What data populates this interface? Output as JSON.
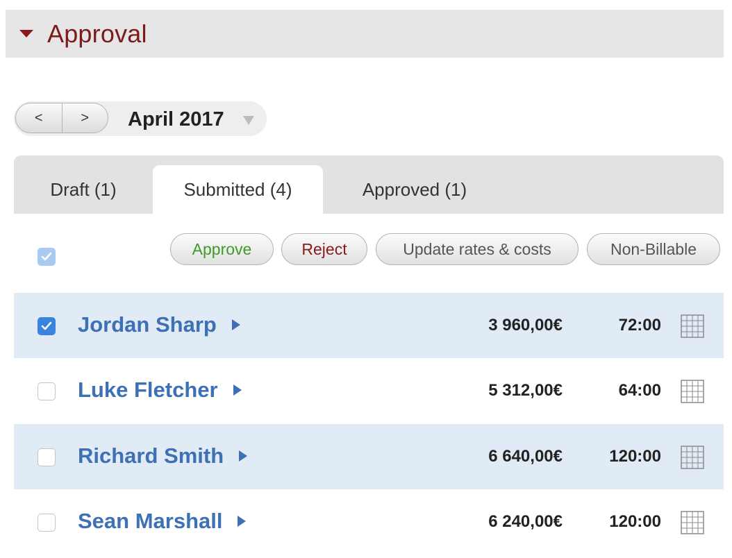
{
  "section": {
    "title": "Approval"
  },
  "month_nav": {
    "prev_label": "<",
    "next_label": ">",
    "month": "April 2017"
  },
  "tabs": [
    {
      "label": "Draft (1)",
      "active": false
    },
    {
      "label": "Submitted (4)",
      "active": true
    },
    {
      "label": "Approved (1)",
      "active": false
    }
  ],
  "toolbar": {
    "approve_label": "Approve",
    "reject_label": "Reject",
    "update_label": "Update rates & costs",
    "nonbillable_label": "Non-Billable"
  },
  "colors": {
    "approve": "#3f9a2a",
    "reject": "#8b1a1a",
    "name": "#3d70b5",
    "accent_check": "#3a84e0"
  },
  "rows": [
    {
      "name": "Jordan Sharp",
      "amount": "3 960,00€",
      "hours": "72:00",
      "checked": true
    },
    {
      "name": "Luke Fletcher",
      "amount": "5 312,00€",
      "hours": "64:00",
      "checked": false
    },
    {
      "name": "Richard Smith",
      "amount": "6 640,00€",
      "hours": "120:00",
      "checked": false
    },
    {
      "name": "Sean Marshall",
      "amount": "6 240,00€",
      "hours": "120:00",
      "checked": false
    }
  ]
}
